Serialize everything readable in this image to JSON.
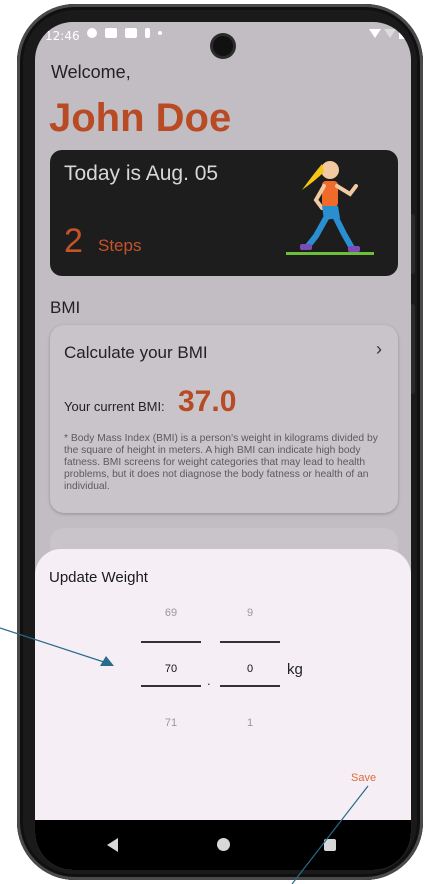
{
  "status_bar": {
    "time": "12:46"
  },
  "header": {
    "greeting": "Welcome,",
    "user_name": "John Doe"
  },
  "activity_card": {
    "today_text": "Today is Aug. 05",
    "steps_count": "2",
    "steps_label": "Steps"
  },
  "bmi": {
    "section_title": "BMI",
    "calculate_label": "Calculate your BMI",
    "chevron": "›",
    "current_label": "Your current BMI:",
    "current_value": "37.0",
    "disclaimer": "* Body Mass Index (BMI) is a person's weight in kilograms divided by the square of height in meters. A high BMI can indicate high body fatness. BMI screens for weight categories that may lead to health problems, but it does not diagnose the body fatness or health of an individual."
  },
  "update_weight": {
    "title": "Update Weight",
    "integer_picker": {
      "above": "69",
      "selected": "70",
      "below": "71"
    },
    "decimal_picker": {
      "above": "9",
      "selected": "0",
      "below": "1"
    },
    "separator": ".",
    "unit": "kg",
    "save_label": "Save"
  },
  "colors": {
    "accent": "#b84a24",
    "save": "#e06a3a",
    "sheet": "#f5eff5",
    "annotation": "#2a6a8a"
  }
}
